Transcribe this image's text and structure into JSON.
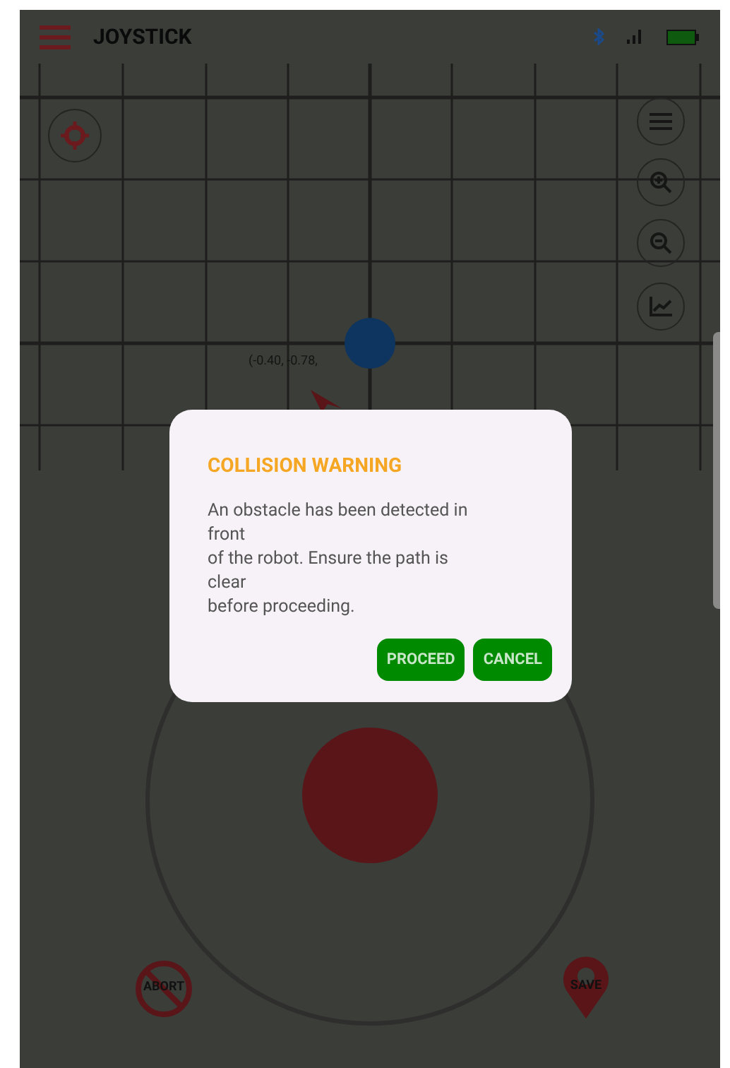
{
  "app_bar": {
    "title": "JOYSTICK"
  },
  "map": {
    "position_label": "(-0.40, -0.78,"
  },
  "dialog": {
    "title": "COLLISION WARNING",
    "message": "An obstacle has been detected in\nfront\nof the robot. Ensure the path is\nclear\nbefore proceeding.",
    "buttons": [
      "PROCEED",
      "CANCEL"
    ]
  },
  "actions": [
    {
      "kind": "abort",
      "label": "ABORT"
    },
    {
      "kind": "save",
      "label": "SAVE"
    }
  ]
}
